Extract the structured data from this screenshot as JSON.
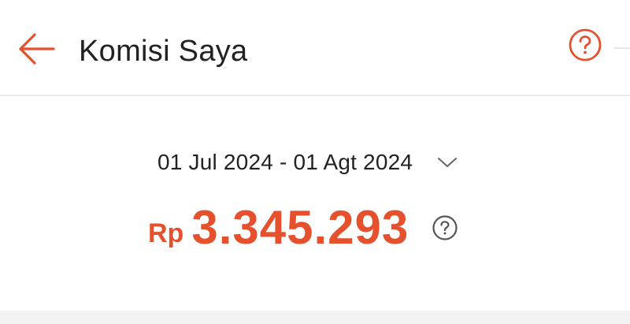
{
  "header": {
    "title": "Komisi Saya",
    "back_icon": "arrow-left-icon",
    "help_icon": "question-circle-icon"
  },
  "commission": {
    "date_range": "01 Jul 2024 - 01 Agt 2024",
    "dropdown_icon": "chevron-down-icon",
    "currency": "Rp",
    "amount": "3.345.293",
    "info_icon": "question-circle-icon"
  },
  "colors": {
    "accent": "#e5502d",
    "text": "#222222",
    "divider": "#ececec",
    "band": "#f3f3f3"
  }
}
